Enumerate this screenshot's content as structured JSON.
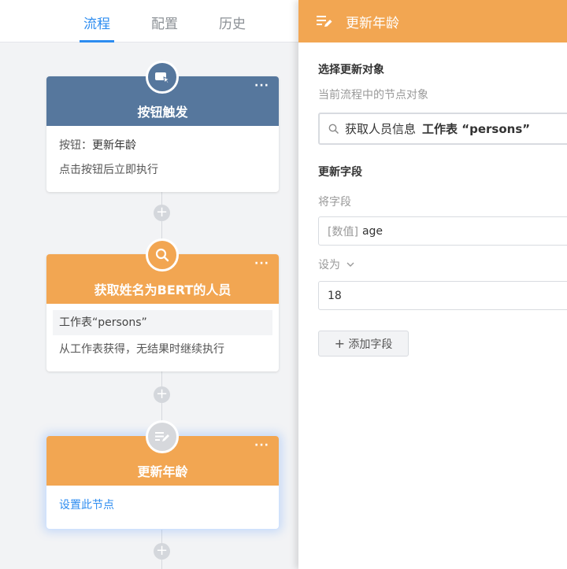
{
  "tabs": [
    {
      "label": "流程",
      "active": true
    },
    {
      "label": "配置",
      "active": false
    },
    {
      "label": "历史",
      "active": false
    }
  ],
  "nodes": [
    {
      "title": "按钮触发",
      "color": "#56779d",
      "icon": "button-click-icon",
      "more": "···",
      "rows": [
        {
          "label": "按钮：",
          "value": "更新年龄"
        },
        {
          "label": "点击按钮后立即执行",
          "value": ""
        }
      ]
    },
    {
      "title": "获取姓名为BERT的人员",
      "color": "#f2a652",
      "icon": "search-icon",
      "more": "···",
      "worksheet": "工作表“persons”",
      "note": "从工作表获得，无结果时继续执行"
    },
    {
      "title": "更新年龄",
      "color": "#f2a652",
      "icon": "edit-list-icon",
      "more": "···",
      "link": "设置此节点",
      "selected": true
    }
  ],
  "add_symbol": "+",
  "panel": {
    "title": "更新年龄",
    "header_color": "#f2a652",
    "select_target_title": "选择更新对象",
    "select_target_hint": "当前流程中的节点对象",
    "target_source": "获取人员信息",
    "target_sheet": "工作表 “persons”",
    "update_fields_title": "更新字段",
    "field_label": "将字段",
    "field_prefix": "[数值]",
    "field_value": "age",
    "set_to_label": "设为",
    "set_to_value": "18",
    "add_field_label": "添加字段",
    "add_field_symbol": "+"
  }
}
